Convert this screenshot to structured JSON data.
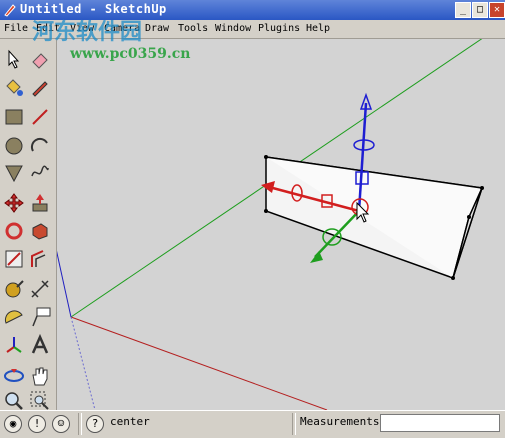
{
  "window": {
    "title": "Untitled - SketchUp"
  },
  "menu": {
    "items": [
      "File",
      "Edit",
      "View",
      "Camera",
      "Draw",
      "Tools",
      "Window",
      "Plugins",
      "Help"
    ]
  },
  "watermark": {
    "text1": "河东软件园",
    "text2": "www.pc0359.cn",
    "text3": "www.pc0359.cn"
  },
  "tools": [
    "select-icon",
    "eraser-icon",
    "paint-bucket-icon",
    "pencil-icon",
    "rectangle-icon",
    "line-icon",
    "circle-icon",
    "arc-icon",
    "polygon-icon",
    "freehand-icon",
    "move-icon",
    "push-pull-icon",
    "rotate-icon",
    "follow-me-icon",
    "scale-icon",
    "offset-icon",
    "tape-measure-icon",
    "dimension-icon",
    "protractor-icon",
    "text-icon",
    "axes-icon",
    "3d-text-icon",
    "orbit-icon",
    "pan-icon",
    "zoom-icon",
    "zoom-window-icon"
  ],
  "status": {
    "hint_text": "center",
    "measurements_label": "Measurements",
    "measurements_value": ""
  },
  "colors": {
    "red_axis": "#d21e1e",
    "green_axis": "#1e9e1e",
    "blue_axis": "#1e1ed2",
    "viewport_bg": "#d3d3d3"
  }
}
